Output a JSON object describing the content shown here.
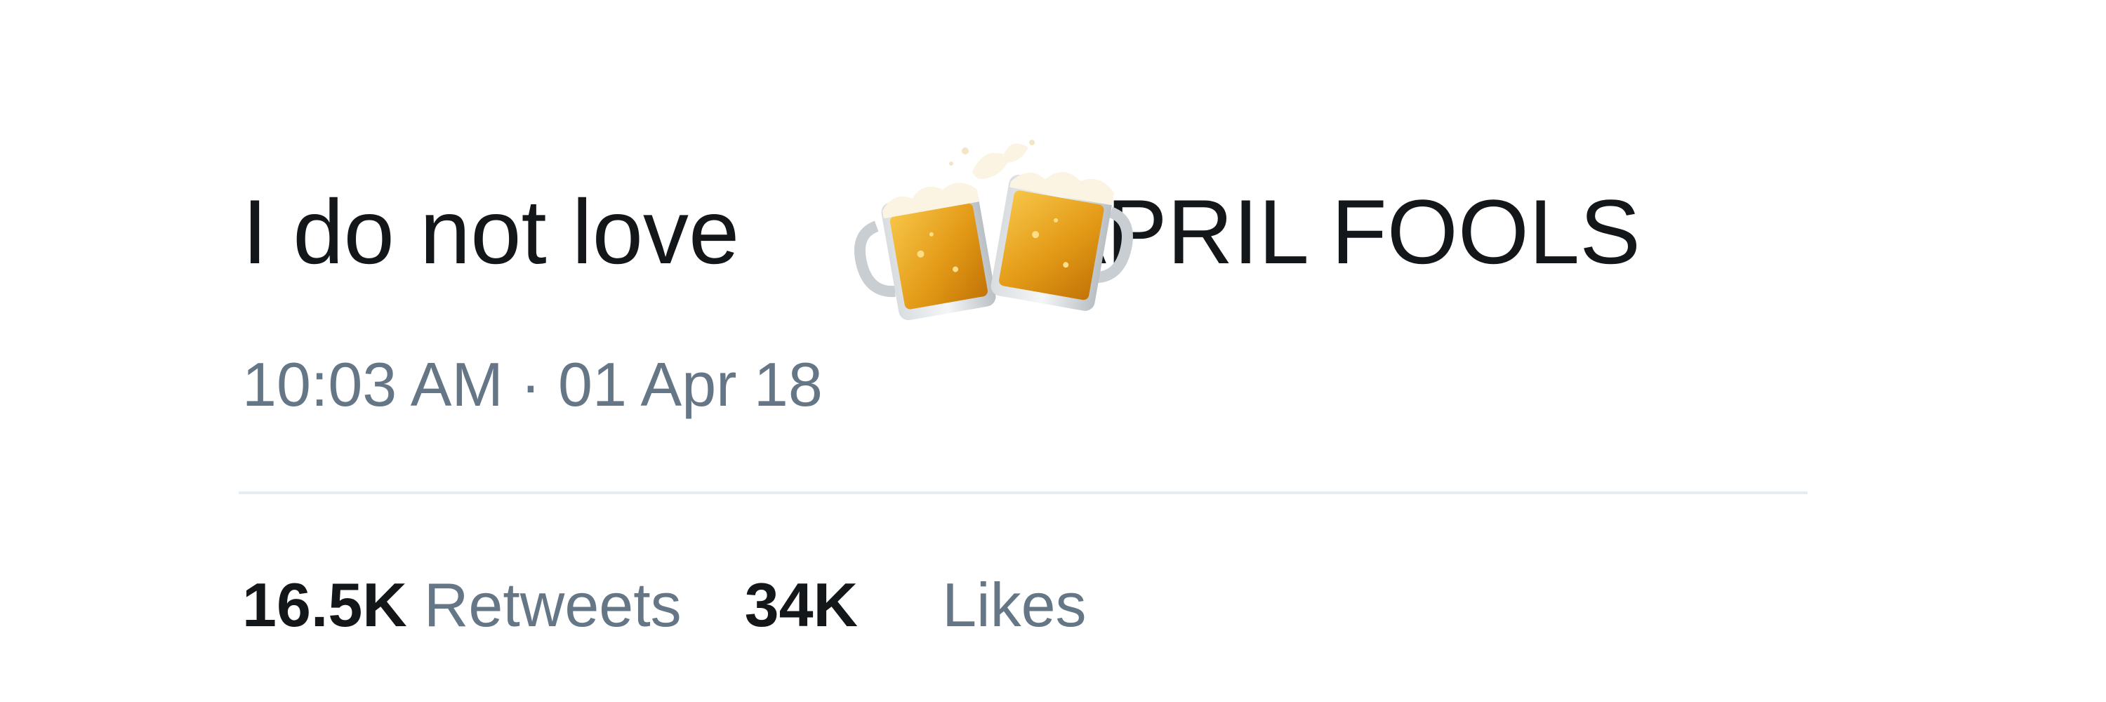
{
  "tweet": {
    "text_before": "I do not love",
    "emoji": "beer-mugs-clinking",
    "text_after": "APRIL FOOLS",
    "time": "10:03 AM",
    "separator": "·",
    "date": "01 Apr 18"
  },
  "stats": {
    "retweets_count": "16.5K",
    "retweets_label": "Retweets",
    "likes_count": "34K",
    "likes_label": "Likes"
  },
  "colors": {
    "text": "#14171a",
    "muted": "#657786",
    "divider": "#e6ecf0",
    "beer": "#e8a21c"
  }
}
